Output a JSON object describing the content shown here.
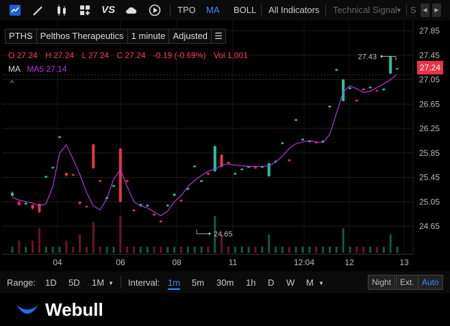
{
  "toolbar": {
    "icons": [
      "chart-type-icon",
      "draw-icon",
      "candles-icon",
      "layout-icon",
      "compare-icon",
      "cloud-icon",
      "replay-icon"
    ],
    "vs_label": "VS",
    "items": [
      "TPO",
      "MA",
      "BOLL"
    ],
    "all_indicators": "All Indicators",
    "technical_signal": "Technical Signal",
    "clipped": "S"
  },
  "symbol_bar": {
    "ticker": "PTHS",
    "company": "Pelthos Therapeutics",
    "interval": "1 minute",
    "adjustment": "Adjusted"
  },
  "ohlc": {
    "o_label": "O",
    "o": "27.24",
    "h_label": "H",
    "h": "27.24",
    "l_label": "L",
    "l": "27.24",
    "c_label": "C",
    "c": "27.24",
    "change": "-0.19 (-0.69%)",
    "vol_label": "Vol",
    "vol": "1,001"
  },
  "ma_legend": {
    "label": "MA",
    "ma5": "MA5 27.14"
  },
  "collapse_glyph": "^",
  "price_tag": "27.24",
  "colors": {
    "up": "#26c29a",
    "down": "#e8334a",
    "ma": "#b03ad6",
    "accent": "#3d8bff"
  },
  "chart_data": {
    "type": "candlestick",
    "y_ticks": [
      "27.85",
      "27.45",
      "27.05",
      "26.65",
      "26.25",
      "25.85",
      "25.45",
      "25.05",
      "24.65"
    ],
    "ylim": [
      24.35,
      27.95
    ],
    "x_ticks": [
      "04",
      "06",
      "08",
      "11",
      "12:04",
      "12",
      "13"
    ],
    "high_label": "27.43",
    "low_label": "24.65",
    "candles": [
      [
        25.15,
        25.2,
        25.22,
        25.13,
        1
      ],
      [
        25.05,
        25.0,
        25.07,
        24.98,
        2
      ],
      [
        25.02,
        25.03,
        25.05,
        25.0,
        1
      ],
      [
        25.0,
        24.94,
        25.01,
        24.92,
        2
      ],
      [
        25.02,
        24.88,
        25.02,
        24.86,
        4
      ],
      [
        25.45,
        25.47,
        25.48,
        25.44,
        1
      ],
      [
        25.6,
        25.62,
        25.63,
        25.59,
        1
      ],
      [
        26.1,
        26.12,
        26.13,
        26.09,
        1
      ],
      [
        25.52,
        25.48,
        25.53,
        25.46,
        2
      ],
      [
        25.5,
        25.49,
        25.51,
        25.48,
        1
      ],
      [
        25.05,
        25.02,
        25.06,
        25.0,
        3
      ],
      [
        24.98,
        24.97,
        24.99,
        24.96,
        1
      ],
      [
        25.99,
        25.6,
        26.0,
        25.59,
        5
      ],
      [
        25.4,
        25.38,
        25.41,
        25.37,
        1
      ],
      [
        25.1,
        25.12,
        25.14,
        25.09,
        1
      ],
      [
        25.3,
        25.32,
        25.33,
        25.29,
        1
      ],
      [
        25.92,
        25.05,
        25.93,
        25.04,
        6
      ],
      [
        25.4,
        25.38,
        25.41,
        25.37,
        1
      ],
      [
        24.92,
        24.9,
        24.93,
        24.89,
        1
      ],
      [
        24.98,
        25.01,
        25.02,
        24.97,
        1
      ],
      [
        24.98,
        25.0,
        25.01,
        24.97,
        1
      ],
      [
        24.85,
        24.83,
        24.86,
        24.82,
        1
      ],
      [
        24.74,
        24.72,
        24.75,
        24.71,
        1
      ],
      [
        24.98,
        25.0,
        25.01,
        24.97,
        1
      ],
      [
        25.15,
        25.18,
        25.19,
        25.14,
        1
      ],
      [
        25.08,
        25.06,
        25.09,
        25.05,
        1
      ],
      [
        25.25,
        25.27,
        25.28,
        25.24,
        1
      ],
      [
        25.62,
        25.64,
        25.65,
        25.61,
        1
      ],
      [
        25.38,
        25.4,
        25.41,
        25.37,
        1
      ],
      [
        25.52,
        25.5,
        25.53,
        25.49,
        1
      ],
      [
        25.55,
        25.96,
        25.97,
        25.54,
        6
      ],
      [
        25.82,
        25.62,
        25.83,
        25.61,
        3
      ],
      [
        25.7,
        25.68,
        25.71,
        25.67,
        1
      ],
      [
        25.5,
        25.52,
        25.53,
        25.49,
        1
      ],
      [
        25.58,
        25.59,
        25.6,
        25.57,
        1
      ],
      [
        25.62,
        25.63,
        25.64,
        25.61,
        1
      ],
      [
        25.62,
        25.6,
        25.63,
        25.59,
        1
      ],
      [
        25.62,
        25.63,
        25.64,
        25.61,
        1
      ],
      [
        25.47,
        25.68,
        25.69,
        25.46,
        3
      ],
      [
        25.7,
        25.72,
        25.73,
        25.69,
        1
      ],
      [
        26.0,
        26.02,
        26.03,
        25.99,
        1
      ],
      [
        25.74,
        25.72,
        25.75,
        25.71,
        1
      ],
      [
        26.38,
        26.4,
        26.41,
        26.37,
        1
      ],
      [
        26.06,
        26.08,
        26.09,
        26.05,
        1
      ],
      [
        26.03,
        26.05,
        26.06,
        26.02,
        1
      ],
      [
        26.03,
        26.02,
        26.04,
        26.01,
        1
      ],
      [
        26.04,
        26.05,
        26.06,
        26.03,
        1
      ],
      [
        26.6,
        26.62,
        26.63,
        26.59,
        1
      ],
      [
        27.2,
        27.22,
        27.23,
        27.19,
        1
      ],
      [
        26.7,
        27.05,
        27.06,
        26.69,
        4
      ],
      [
        26.9,
        26.92,
        26.93,
        26.89,
        1
      ],
      [
        26.72,
        26.7,
        26.73,
        26.69,
        1
      ],
      [
        26.9,
        26.88,
        26.91,
        26.87,
        1
      ],
      [
        26.92,
        26.93,
        26.94,
        26.91,
        1
      ],
      [
        26.88,
        26.87,
        26.89,
        26.86,
        1
      ],
      [
        26.88,
        26.9,
        26.91,
        26.87,
        1
      ],
      [
        27.15,
        27.43,
        27.44,
        27.14,
        3
      ],
      [
        27.24,
        27.24,
        27.24,
        27.24,
        1
      ]
    ],
    "ma5": [
      25.12,
      25.08,
      25.05,
      25.03,
      24.98,
      25.02,
      25.3,
      25.85,
      25.98,
      25.75,
      25.5,
      25.2,
      24.98,
      24.92,
      25.1,
      25.42,
      25.58,
      25.3,
      25.05,
      24.98,
      24.95,
      24.88,
      24.82,
      24.9,
      25.05,
      25.15,
      25.3,
      25.4,
      25.48,
      25.55,
      25.58,
      25.65,
      25.67,
      25.65,
      25.64,
      25.63,
      25.63,
      25.63,
      25.64,
      25.7,
      25.8,
      25.92,
      26.0,
      26.03,
      26.05,
      26.03,
      26.02,
      26.15,
      26.5,
      26.85,
      26.95,
      26.9,
      26.84,
      26.86,
      26.92,
      26.98,
      27.05,
      27.14
    ],
    "volume_text": "Vol"
  },
  "range": {
    "label": "Range:",
    "options": [
      "1D",
      "5D",
      "1M"
    ]
  },
  "interval": {
    "label": "Interval:",
    "options": [
      "1m",
      "5m",
      "30m",
      "1h",
      "D",
      "W",
      "M"
    ],
    "selected": "1m"
  },
  "session": [
    "Night",
    "Ext.",
    "Auto"
  ],
  "brand": {
    "name": "Webull"
  }
}
